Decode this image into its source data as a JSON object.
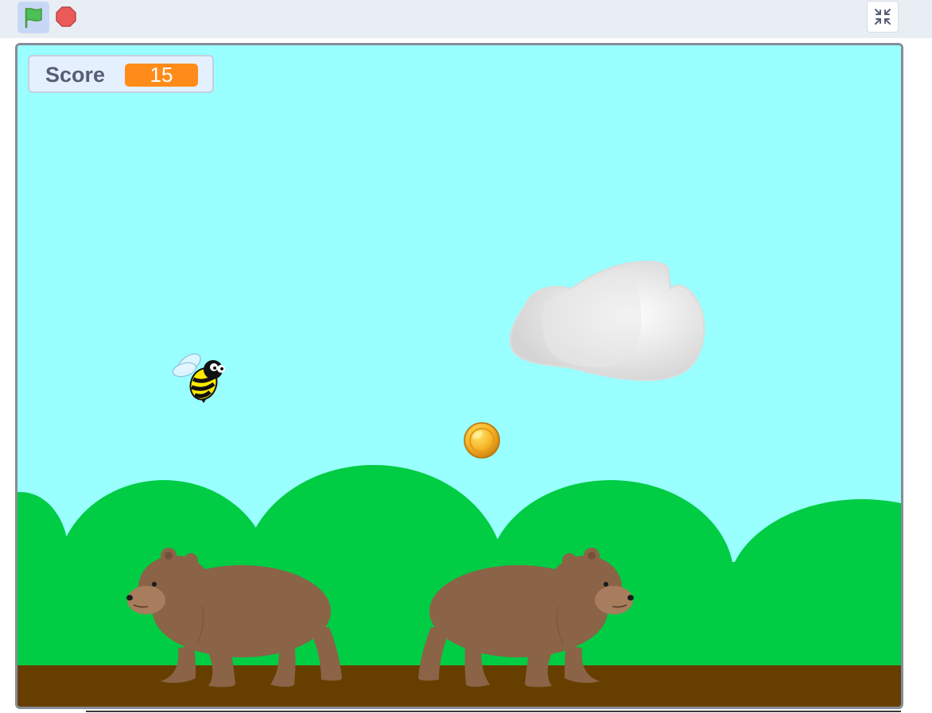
{
  "toolbar": {
    "green_flag_icon": "green-flag-icon",
    "stop_icon": "stop-sign-icon",
    "fullscreen_icon": "exit-fullscreen-icon"
  },
  "monitor": {
    "label": "Score",
    "value": "15"
  },
  "colors": {
    "sky": "#99ffff",
    "hills": "#00cc44",
    "ground": "#663f00",
    "monitor_value_bg": "#ff8c1a",
    "flag_active_bg": "#c6d8f5"
  }
}
